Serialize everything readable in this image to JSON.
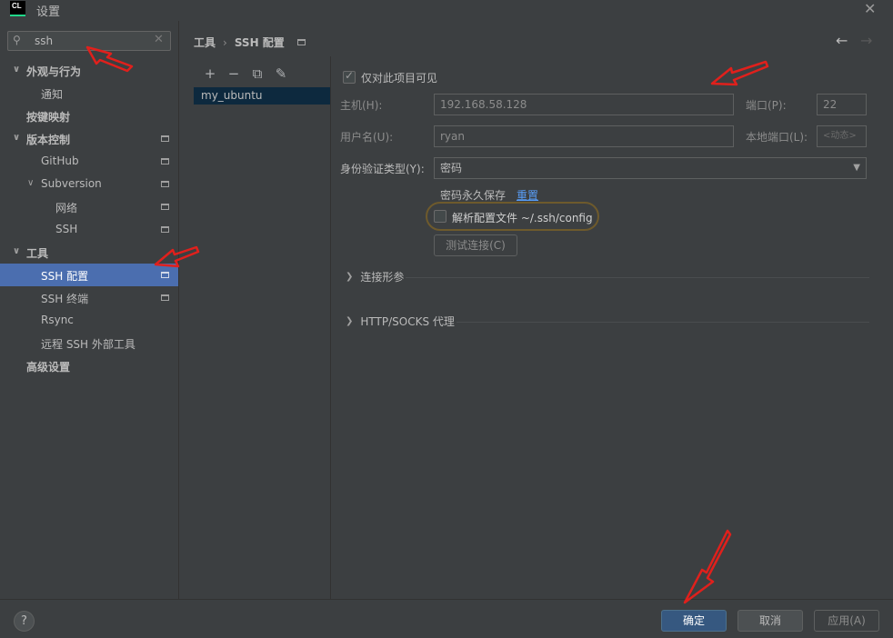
{
  "window": {
    "app_icon": "CL",
    "title": "设置",
    "close_label": "✕"
  },
  "search": {
    "value": "ssh",
    "icon": "search-icon",
    "clear": "✕"
  },
  "sidebar": {
    "items": [
      {
        "label": "外观与行为",
        "expander": "∨"
      },
      {
        "label": "通知"
      },
      {
        "label": "按键映射"
      },
      {
        "label": "版本控制",
        "expander": "∨"
      },
      {
        "label": "GitHub"
      },
      {
        "label": "Subversion",
        "expander": "∨"
      },
      {
        "label": "网络"
      },
      {
        "label": "SSH"
      },
      {
        "label": "工具",
        "expander": "∨"
      },
      {
        "label": "SSH 配置"
      },
      {
        "label": "SSH 终端"
      },
      {
        "label": "Rsync"
      },
      {
        "label": "远程 SSH 外部工具"
      },
      {
        "label": "高级设置"
      }
    ]
  },
  "breadcrumb": {
    "parent": "工具",
    "separator": "›",
    "current": "SSH 配置"
  },
  "nav": {
    "back": "←",
    "forward": "→"
  },
  "list": {
    "toolbar": {
      "add": "+",
      "remove": "−",
      "copy": "⧉",
      "edit": "✎"
    },
    "hosts": [
      "my_ubuntu"
    ]
  },
  "form": {
    "visible_only_project": "仅对此项目可见",
    "host_label": "主机(H):",
    "host_value": "192.168.58.128",
    "port_label": "端口(P):",
    "port_value": "22",
    "username_label": "用户名(U):",
    "username_value": "ryan",
    "local_port_label": "本地端口(L):",
    "local_port_placeholder": "<动态>",
    "auth_label": "身份验证类型(Y):",
    "auth_value": "密码",
    "remember_password": "密码永久保存",
    "reset_link": "重置",
    "parse_config": "解析配置文件 ~/.ssh/config",
    "test_button": "测试连接(C)",
    "section_connection": "连接形参",
    "section_proxy": "HTTP/SOCKS 代理"
  },
  "footer": {
    "help": "?",
    "ok": "确定",
    "cancel": "取消",
    "apply": "应用(A)"
  },
  "colors": {
    "selected": "#4b6eaf",
    "link": "#589df6",
    "annotation": "#e0201c",
    "ok_button": "#365880"
  }
}
